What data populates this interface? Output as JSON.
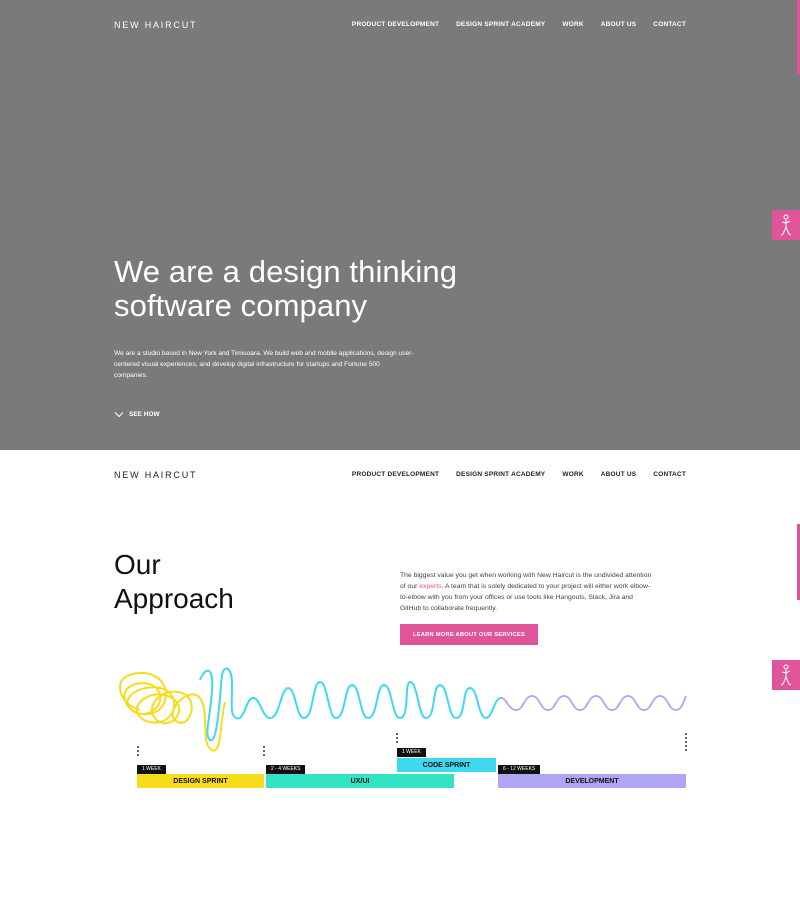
{
  "brand": {
    "logo_text": "NEW HAIRCUT",
    "accent_color": "#e0549a"
  },
  "nav": {
    "items": [
      {
        "label": "PRODUCT DEVELOPMENT"
      },
      {
        "label": "DESIGN SPRINT ACADEMY"
      },
      {
        "label": "WORK"
      },
      {
        "label": "ABOUT US"
      },
      {
        "label": "CONTACT"
      }
    ]
  },
  "hero": {
    "title_line1": "We are a design thinking",
    "title_line2": "software company",
    "description": "We are a studio based in New York and Timisoara. We build web and mobile applications, design user-centered visual experiences, and develop digital infrastructure for startups and Fortune 500 companies.",
    "see_how_label": "SEE HOW",
    "background_color": "#7a7a7a"
  },
  "approach": {
    "title_line1": "Our",
    "title_line2": "Approach",
    "text_before_link": "The biggest value you get when working with New Haircut is the undivided attention of our ",
    "link_text": "experts",
    "text_after_link": ". A team that is solely dedicated to your project will either work elbow-to-elbow with you from your offices or use tools like Hangouts, Slack, Jira and GitHub to collaborate frequently.",
    "cta_label": "LEARN MORE ABOUT OUR SERVICES"
  },
  "timeline": {
    "phases": [
      {
        "name": "DESIGN SPRINT",
        "duration": "1 WEEK",
        "color": "#f7dc1d"
      },
      {
        "name": "UX/UI",
        "duration": "2 - 4 WEEKS",
        "color": "#34e3c3"
      },
      {
        "name": "CODE SPRINT",
        "duration": "1 WEEK",
        "color": "#3fd9ef"
      },
      {
        "name": "DEVELOPMENT",
        "duration": "6 - 12 WEEKS",
        "color": "#aea6f2"
      }
    ],
    "line_colors": {
      "scribble": "#f7dc1d",
      "loops": "#3fd9ef",
      "waves": "#aea6f2"
    }
  },
  "icons": {
    "side_tab": "robot-figure-icon",
    "see_how": "chevron-down-icon"
  }
}
